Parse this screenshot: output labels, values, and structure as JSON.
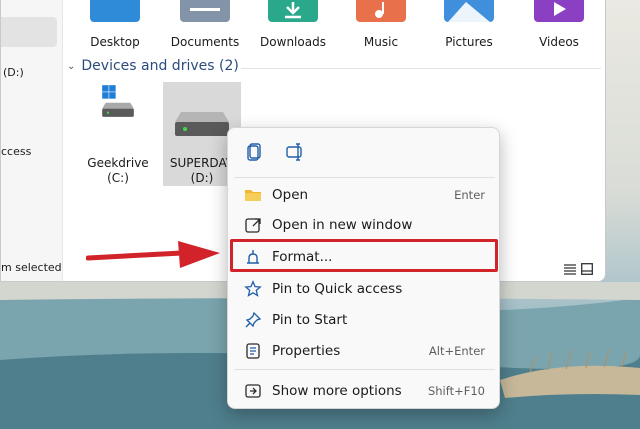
{
  "sidebar": {
    "items": [
      {
        "label": "(D:)"
      },
      {
        "label": "ccess"
      }
    ]
  },
  "status": {
    "text": "m selected"
  },
  "folders": [
    {
      "label": "Desktop",
      "icon": "desktop-folder-icon"
    },
    {
      "label": "Documents",
      "icon": "documents-folder-icon"
    },
    {
      "label": "Downloads",
      "icon": "downloads-folder-icon"
    },
    {
      "label": "Music",
      "icon": "music-folder-icon"
    },
    {
      "label": "Pictures",
      "icon": "pictures-folder-icon"
    },
    {
      "label": "Videos",
      "icon": "videos-folder-icon"
    }
  ],
  "section": {
    "title": "Devices and drives (2)"
  },
  "drives": [
    {
      "name": "Geekdrive",
      "letter": "(C:)"
    },
    {
      "name": "SUPERDAV",
      "letter": "(D:)"
    }
  ],
  "context_menu": {
    "toolbar_icons": [
      "copy-icon",
      "rename-icon"
    ],
    "items": [
      {
        "label": "Open",
        "shortcut": "Enter",
        "icon": "folder-open-icon"
      },
      {
        "label": "Open in new window",
        "shortcut": "",
        "icon": "open-new-window-icon"
      },
      {
        "label": "Format...",
        "shortcut": "",
        "icon": "format-drive-icon"
      },
      {
        "label": "Pin to Quick access",
        "shortcut": "",
        "icon": "star-icon"
      },
      {
        "label": "Pin to Start",
        "shortcut": "",
        "icon": "pin-icon"
      },
      {
        "label": "Properties",
        "shortcut": "Alt+Enter",
        "icon": "properties-icon"
      },
      {
        "label": "Show more options",
        "shortcut": "Shift+F10",
        "icon": "more-options-icon"
      }
    ]
  },
  "colors": {
    "accent": "#0067c0",
    "highlight_box": "#d2232a",
    "arrow": "#d2232a"
  }
}
